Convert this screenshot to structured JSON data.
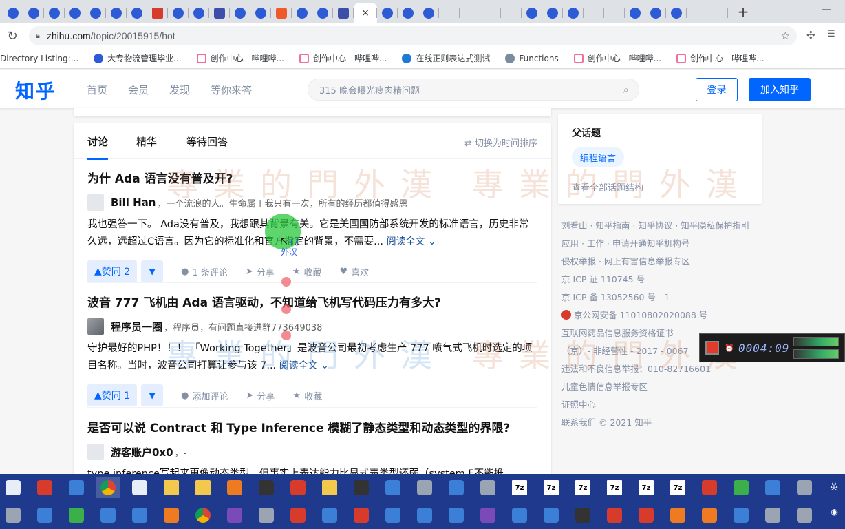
{
  "browser": {
    "tabs": [
      "paw",
      "paw",
      "paw",
      "paw",
      "paw",
      "paw",
      "paw",
      "red",
      "paw",
      "paw",
      "dark",
      "paw",
      "paw",
      "orange",
      "paw",
      "paw",
      "dark",
      "active",
      "paw",
      "paw",
      "paw",
      "green",
      "green",
      "green",
      "green",
      "paw",
      "paw",
      "paw",
      "green",
      "green",
      "paw",
      "paw",
      "paw",
      "green",
      "green"
    ],
    "active_tab_close": "×",
    "new_tab": "+",
    "window_control": "—",
    "url_host": "zhihu.com",
    "url_path": "/topic/20015915/hot"
  },
  "bookmarks": [
    {
      "label": "Directory Listing:...",
      "icon": "none"
    },
    {
      "label": "大专物流管理毕业...",
      "icon": "blue"
    },
    {
      "label": "创作中心 - 哔哩哔...",
      "icon": "tv"
    },
    {
      "label": "创作中心 - 哔哩哔...",
      "icon": "tv"
    },
    {
      "label": "在线正则表达式测试",
      "icon": "regex"
    },
    {
      "label": "Functions",
      "icon": "fn"
    },
    {
      "label": "创作中心 - 哔哩哔...",
      "icon": "tv"
    },
    {
      "label": "创作中心 - 哔哩哔...",
      "icon": "tv"
    }
  ],
  "header": {
    "logo": "知乎",
    "nav": [
      "首页",
      "会员",
      "发现",
      "等你来答"
    ],
    "search_placeholder": "315 晚会曝光瘦肉精问题",
    "login": "登录",
    "join": "加入知乎"
  },
  "main": {
    "tabs": [
      "讨论",
      "精华",
      "等待回答"
    ],
    "sort_toggle": "切换为时间排序",
    "items": [
      {
        "title": "为什 Ada 语言没有普及开?",
        "author": "Bill Han",
        "bio": "，一个流浪的人。生命属于我只有一次，所有的经历都值得感恩",
        "excerpt": "我也强答一下。 Ada没有普及，我想跟其背景有关。它是美国国防部系统开发的标准语言，历史非常久远，远超过C语言。因为它的标准化和官方指定的背景，不需要...",
        "read_more": "阅读全文",
        "vote": "赞同 2",
        "actions": [
          "1 条评论",
          "分享",
          "收藏",
          "喜欢"
        ]
      },
      {
        "title": "波音 777 飞机由 Ada 语言驱动，不知道给飞机写代码压力有多大?",
        "author": "程序员一圈",
        "bio": "，程序员，有问题直接进群773649038",
        "excerpt": "守护最好的PHP！！！ 「Working Together」是波音公司最初考虑生产 777 喷气式飞机时选定的项目名称。当时，波音公司打算让参与该 7...",
        "read_more": "阅读全文",
        "vote": "赞同 1",
        "actions": [
          "添加评论",
          "分享",
          "收藏"
        ]
      },
      {
        "title": "是否可以说 Contract 和 Type Inference 模糊了静态类型和动态类型的界限?",
        "author": "游客账户0x0",
        "bio": "，-",
        "excerpt": "type inference写起来更像动态类型，但事实上表达能力比显式表类型还弱（system F不能推"
      }
    ]
  },
  "sidebar": {
    "title": "父话题",
    "tag": "编程语言",
    "link": "查看全部话题结构",
    "footer": [
      "刘看山 · 知乎指南 · 知乎协议 · 知乎隐私保护指引",
      "应用 · 工作 · 申请开通知乎机构号",
      "侵权举报 · 网上有害信息举报专区",
      "京 ICP 证 110745 号",
      "京 ICP 备 13052560 号 - 1",
      "京公网安备 11010802020088 号",
      "互联网药品信息服务资格证书",
      "（京）- 非经营性 - 2017 - 0067",
      "违法和不良信息举报：010-82716601",
      "儿童色情信息举报专区",
      "证照中心",
      "联系我们 © 2021 知乎"
    ]
  },
  "overlay": {
    "watermark_text": "專業的門外漢",
    "cursor_label_1": "门",
    "cursor_label_2": "外汉",
    "recorder_time": "0004:09"
  },
  "taskbar": {
    "row1": [
      "doc",
      "red",
      "blue",
      "chrome",
      "doc",
      "folder",
      "folder",
      "orange",
      "dark",
      "red",
      "folder",
      "dark",
      "blue",
      "gray",
      "blue",
      "gray",
      "z7",
      "z7",
      "z7",
      "z7",
      "z7",
      "z7",
      "red",
      "green",
      "blue",
      "gray"
    ],
    "row2": [
      "gray",
      "blue",
      "green",
      "blue",
      "blue",
      "orange",
      "chrome",
      "purple",
      "gray",
      "red",
      "blue",
      "red",
      "blue",
      "blue",
      "blue",
      "purple",
      "blue",
      "blue",
      "dark",
      "red",
      "red",
      "orange",
      "orange",
      "blue",
      "gray",
      "gray"
    ],
    "tray_top": "英",
    "tray_bottom": "◉"
  },
  "colors": {
    "zhihu_blue": "#0066ff",
    "link_blue": "#175199",
    "meta_gray": "#8590a6",
    "taskbar": "#1f3a8c"
  }
}
